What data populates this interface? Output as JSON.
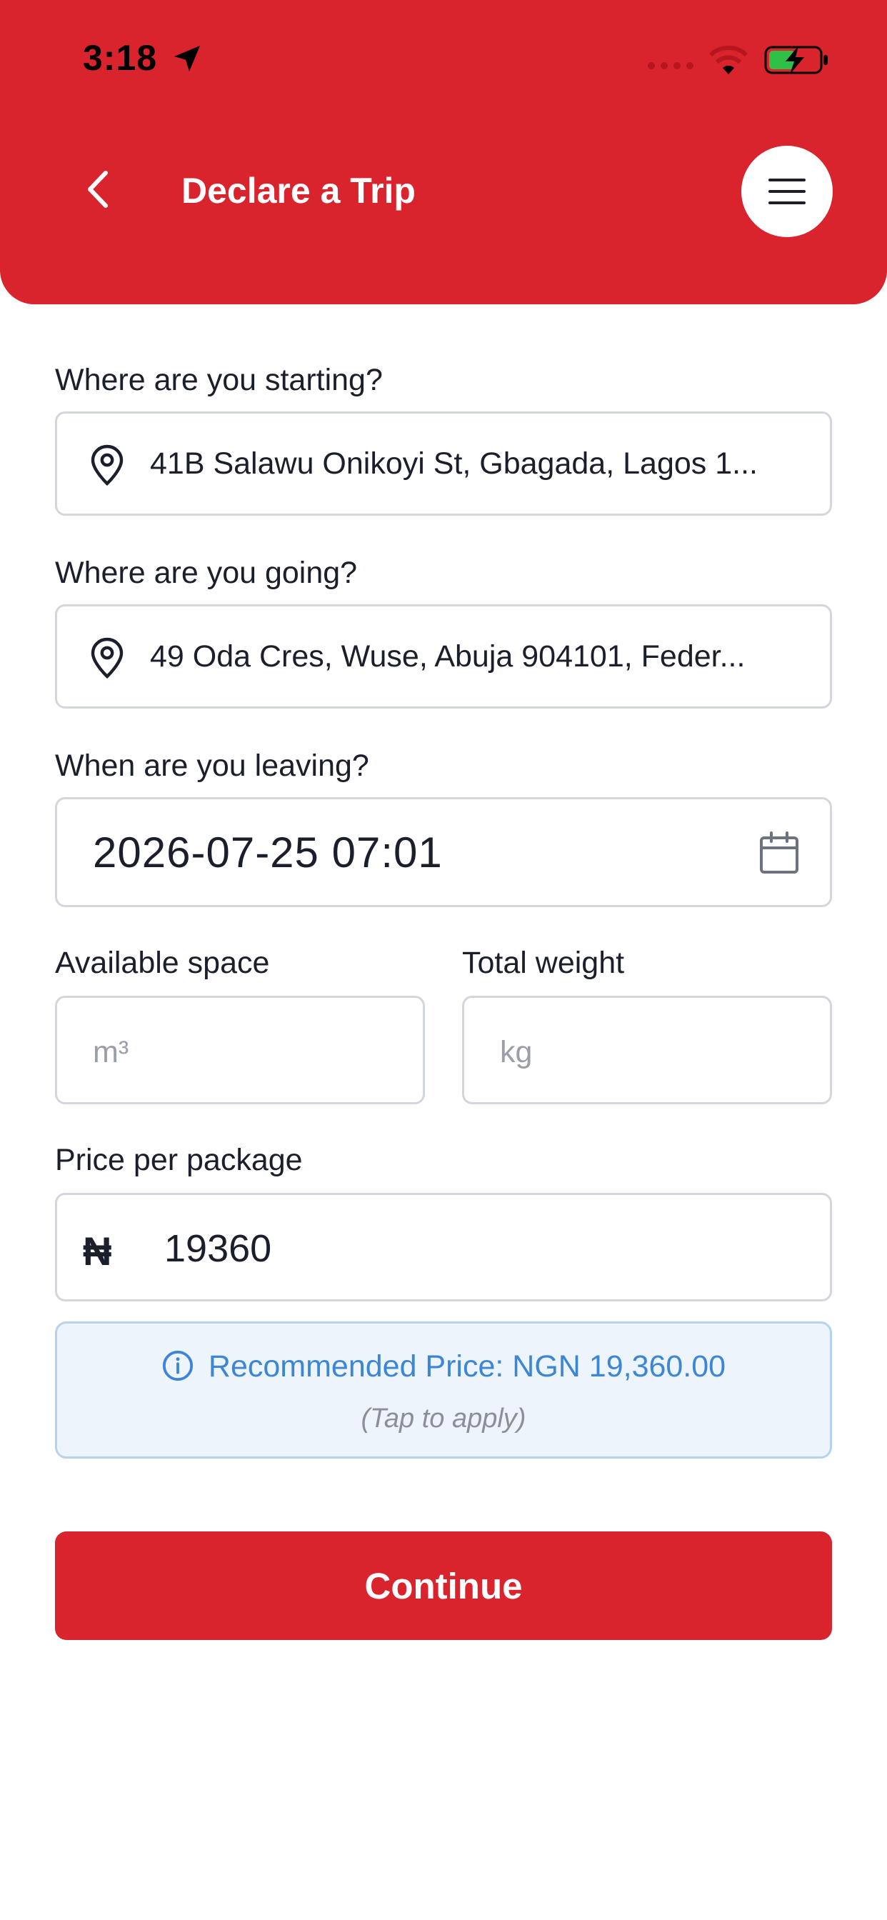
{
  "status_bar": {
    "time": "3:18",
    "icons": [
      "location-arrow-icon",
      "signal-dots-icon",
      "wifi-icon",
      "battery-charging-icon"
    ]
  },
  "header": {
    "title": "Declare a Trip",
    "back_icon": "chevron-left-icon",
    "menu_icon": "hamburger-menu-icon",
    "background_color": "#d9232d"
  },
  "form": {
    "start": {
      "label": "Where are you starting?",
      "value": "41B Salawu Onikoyi St, Gbagada, Lagos 1...",
      "icon": "location-pin-icon"
    },
    "destination": {
      "label": "Where are you going?",
      "value": "49 Oda Cres, Wuse, Abuja 904101, Feder...",
      "icon": "location-pin-icon"
    },
    "departure": {
      "label": "When are you leaving?",
      "value": "2026-07-25 07:01",
      "icon": "calendar-icon"
    },
    "available_space": {
      "label": "Available space",
      "placeholder": "m³"
    },
    "total_weight": {
      "label": "Total weight",
      "placeholder": "kg"
    },
    "price": {
      "label": "Price per package",
      "currency_symbol": "₦",
      "value": "19360"
    },
    "recommendation": {
      "text": "Recommended Price: NGN 19,360.00",
      "hint": "(Tap to apply)",
      "icon": "info-icon"
    }
  },
  "actions": {
    "continue_label": "Continue"
  }
}
